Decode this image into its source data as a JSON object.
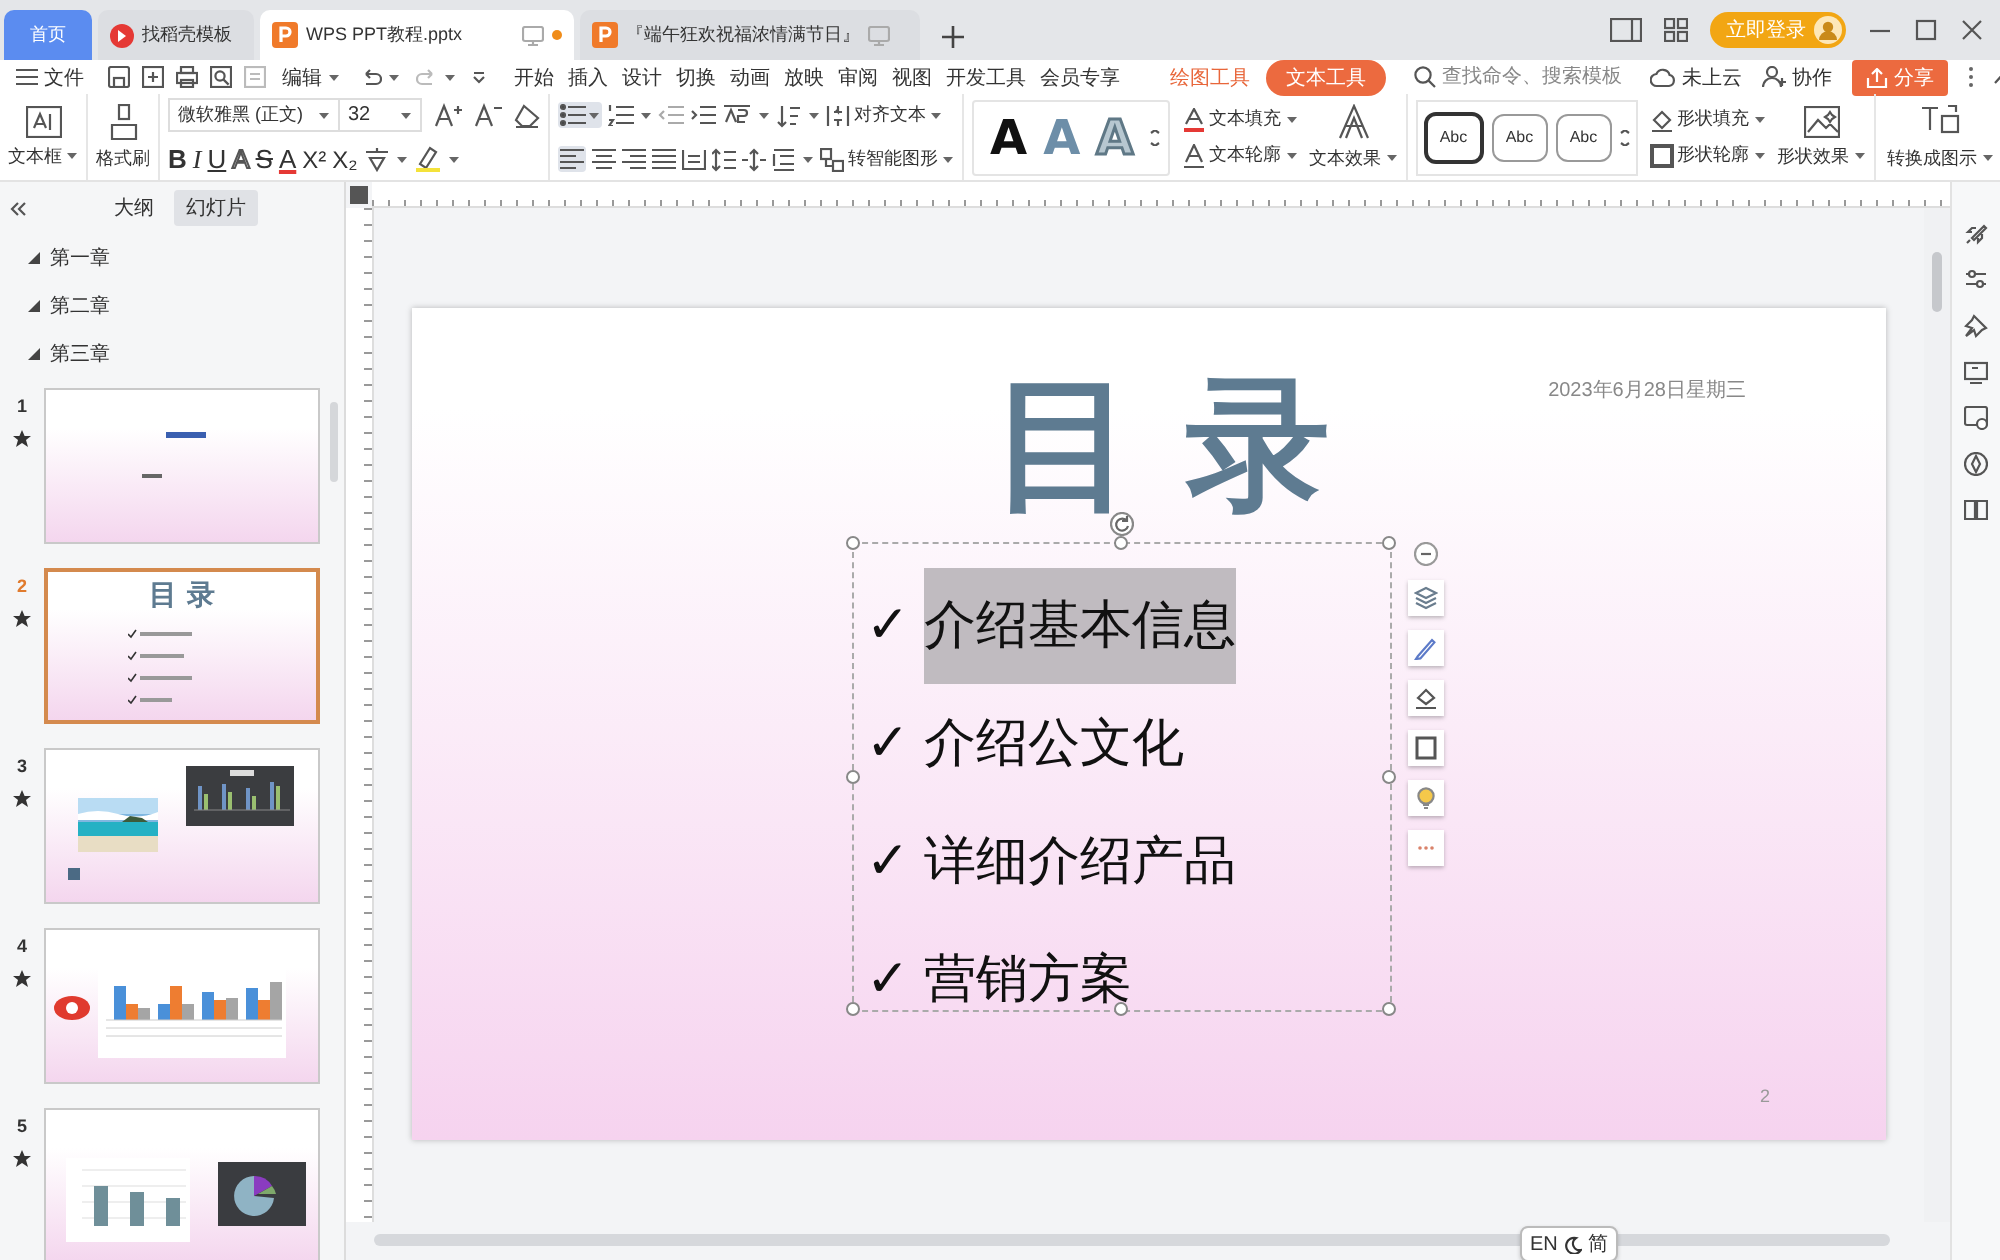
{
  "tabs": [
    {
      "label": "首页",
      "kind": "home",
      "selected": false
    },
    {
      "label": "找稻壳模板",
      "kind": "docer",
      "selected": false
    },
    {
      "label": "WPS PPT教程.pptx",
      "kind": "doc",
      "selected": true,
      "modified": true
    },
    {
      "label": "『端午狂欢祝福浓情满节日』",
      "kind": "doc",
      "selected": false,
      "modified": false
    }
  ],
  "account": {
    "login": "立即登录"
  },
  "menu": {
    "file": "文件",
    "edit": "编辑",
    "tabs": [
      {
        "label": "开始",
        "kind": "main",
        "selected": false
      },
      {
        "label": "插入",
        "kind": "main",
        "selected": false
      },
      {
        "label": "设计",
        "kind": "main",
        "selected": false
      },
      {
        "label": "切换",
        "kind": "main",
        "selected": false
      },
      {
        "label": "动画",
        "kind": "main",
        "selected": false
      },
      {
        "label": "放映",
        "kind": "main",
        "selected": false
      },
      {
        "label": "审阅",
        "kind": "main",
        "selected": false
      },
      {
        "label": "视图",
        "kind": "main",
        "selected": false
      },
      {
        "label": "开发工具",
        "kind": "main",
        "selected": false
      },
      {
        "label": "会员专享",
        "kind": "main",
        "selected": false
      },
      {
        "label": "绘图工具",
        "kind": "context",
        "selected": false
      },
      {
        "label": "文本工具",
        "kind": "context",
        "selected": true
      }
    ],
    "search": {
      "placeholder": "查找命令、搜索模板"
    },
    "cloud": "未上云",
    "collab": "协作",
    "share": "分享"
  },
  "ribbon": {
    "textbox": "文本框",
    "format_painter": "格式刷",
    "font": "微软雅黑 (正文)",
    "size": "32",
    "format_buttons": [
      {
        "label": "B",
        "kind": "bold"
      },
      {
        "label": "I",
        "kind": "italic"
      },
      {
        "label": "U",
        "kind": "underline"
      },
      {
        "label": "A",
        "kind": "shadow"
      },
      {
        "label": "S",
        "kind": "strike"
      },
      {
        "label": "A",
        "kind": "color"
      },
      {
        "label": "X²",
        "kind": "plain"
      },
      {
        "label": "X₂",
        "kind": "plain"
      }
    ],
    "align_text": "对齐文本",
    "smart_art": "转智能图形",
    "wordart_styles": [
      {
        "label": "A",
        "kind": "black"
      },
      {
        "label": "A",
        "kind": "blue"
      },
      {
        "label": "A",
        "kind": "outline"
      }
    ],
    "text_fill": "文本填充",
    "text_outline": "文本轮廓",
    "text_effect": "文本效果",
    "shape_styles": [
      {
        "label": "Abc",
        "selected": true
      },
      {
        "label": "Abc",
        "selected": false
      },
      {
        "label": "Abc",
        "selected": false
      }
    ],
    "shape_fill": "形状填充",
    "shape_outline": "形状轮廓",
    "shape_effect": "形状效果",
    "convert": "转换成图示"
  },
  "panel": {
    "tabs": [
      {
        "label": "大纲",
        "selected": false
      },
      {
        "label": "幻灯片",
        "selected": true
      }
    ],
    "sections": [
      "第一章",
      "第二章",
      "第三章"
    ],
    "slides": [
      {
        "number": "1",
        "kind": "title",
        "selected": false
      },
      {
        "number": "2",
        "kind": "toc",
        "title": "目 录",
        "selected": true
      },
      {
        "number": "3",
        "kind": "photo-chart",
        "selected": false
      },
      {
        "number": "4",
        "kind": "bar-chart",
        "selected": false
      },
      {
        "number": "5",
        "kind": "chart-pie",
        "selected": false
      }
    ]
  },
  "slide": {
    "date": "2023年6月28日星期三",
    "title": "目 录",
    "items": [
      {
        "mark": "✓",
        "text": "介绍基本信息",
        "selected": true
      },
      {
        "mark": "✓",
        "text": "介绍公文化",
        "selected": false
      },
      {
        "mark": "✓",
        "text": "详细介绍产品",
        "selected": false
      },
      {
        "mark": "✓",
        "text": "营销方案",
        "selected": false
      }
    ],
    "page": "2"
  },
  "ime": {
    "lang": "EN",
    "mode": "简"
  }
}
